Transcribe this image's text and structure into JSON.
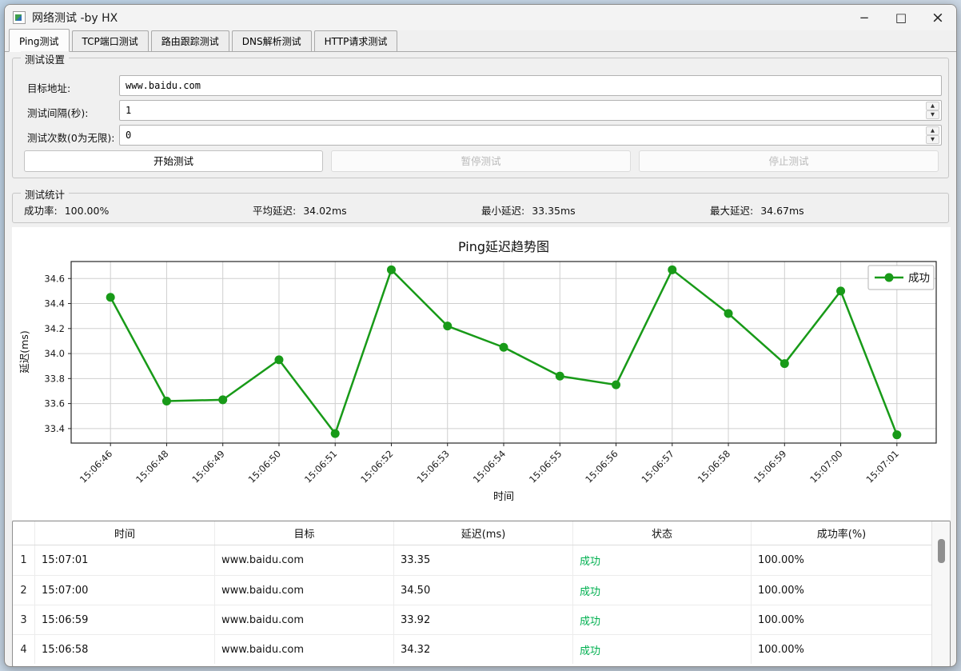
{
  "window": {
    "title": "网络测试 -by HX",
    "controls": [
      {
        "name": "minimize",
        "glyph": "−"
      },
      {
        "name": "maximize",
        "glyph": "□"
      },
      {
        "name": "close",
        "glyph": "×"
      }
    ]
  },
  "icons": {
    "spin_up": "▲",
    "spin_down": "▼"
  },
  "tabs": [
    {
      "label": "Ping测试",
      "active": true
    },
    {
      "label": "TCP端口测试",
      "active": false
    },
    {
      "label": "路由跟踪测试",
      "active": false
    },
    {
      "label": "DNS解析测试",
      "active": false
    },
    {
      "label": "HTTP请求测试",
      "active": false
    }
  ],
  "settings": {
    "group_title": "测试设置",
    "fields": [
      {
        "label": "目标地址:",
        "value": "www.baidu.com",
        "type": "text"
      },
      {
        "label": "测试间隔(秒):",
        "value": "1",
        "type": "spin"
      },
      {
        "label": "测试次数(0为无限):",
        "value": "0",
        "type": "spin"
      }
    ],
    "buttons": [
      {
        "label": "开始测试",
        "enabled": true
      },
      {
        "label": "暂停测试",
        "enabled": false
      },
      {
        "label": "停止测试",
        "enabled": false
      }
    ]
  },
  "stats": {
    "group_title": "测试统计",
    "items": [
      {
        "label": "成功率:",
        "value": "100.00%"
      },
      {
        "label": "平均延迟:",
        "value": "34.02ms"
      },
      {
        "label": "最小延迟:",
        "value": "33.35ms"
      },
      {
        "label": "最大延迟:",
        "value": "34.67ms"
      }
    ]
  },
  "chart_data": {
    "type": "line",
    "title": "Ping延迟趋势图",
    "xlabel": "时间",
    "ylabel": "延迟(ms)",
    "categories": [
      "15:06:46",
      "15:06:48",
      "15:06:49",
      "15:06:50",
      "15:06:51",
      "15:06:52",
      "15:06:53",
      "15:06:54",
      "15:06:55",
      "15:06:56",
      "15:06:57",
      "15:06:58",
      "15:06:59",
      "15:07:00",
      "15:07:01"
    ],
    "series": [
      {
        "name": "成功",
        "color": "#189a18",
        "values": [
          34.45,
          33.62,
          33.63,
          33.95,
          33.36,
          34.67,
          34.22,
          34.05,
          33.82,
          33.75,
          34.67,
          34.32,
          33.92,
          34.5,
          33.35
        ]
      }
    ],
    "yticks": [
      33.4,
      33.6,
      33.8,
      34.0,
      34.2,
      34.4,
      34.6
    ],
    "ylim": [
      33.284,
      34.736
    ],
    "grid": true,
    "grid_color": "#cfcfcf",
    "legend_position": "upper right"
  },
  "table": {
    "columns": [
      "时间",
      "目标",
      "延迟(ms)",
      "状态",
      "成功率(%)"
    ],
    "status_color": "#00b050",
    "rows": [
      {
        "num": "1",
        "time": "15:07:01",
        "target": "www.baidu.com",
        "latency": "33.35",
        "status": "成功",
        "rate": "100.00%"
      },
      {
        "num": "2",
        "time": "15:07:00",
        "target": "www.baidu.com",
        "latency": "34.50",
        "status": "成功",
        "rate": "100.00%"
      },
      {
        "num": "3",
        "time": "15:06:59",
        "target": "www.baidu.com",
        "latency": "33.92",
        "status": "成功",
        "rate": "100.00%"
      },
      {
        "num": "4",
        "time": "15:06:58",
        "target": "www.baidu.com",
        "latency": "34.32",
        "status": "成功",
        "rate": "100.00%"
      }
    ]
  }
}
